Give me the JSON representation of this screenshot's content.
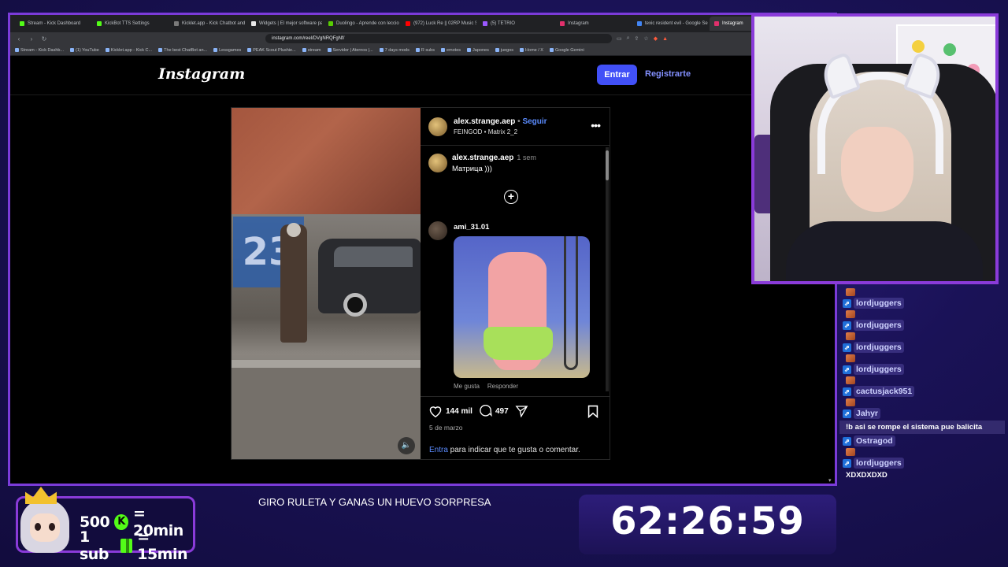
{
  "browser": {
    "tabs": [
      {
        "label": "Stream - Kick Dashboard",
        "color": "#53fc18"
      },
      {
        "label": "KickBot TTS Settings",
        "color": "#53fc18"
      },
      {
        "label": "Kicklet.app - Kick Chatbot and Ov...",
        "color": "#7a7a7a"
      },
      {
        "label": "Widgets | El mejor software para ...",
        "color": "#e8e8e8"
      },
      {
        "label": "Duolingo - Aprende con lecciones ...",
        "color": "#58cc02"
      },
      {
        "label": "(972) Luck Re || 02RP Music Sessio...",
        "color": "#ff0000"
      },
      {
        "label": "(5) TETRIO",
        "color": "#9b59ff"
      },
      {
        "label": "Instagram",
        "color": "#e1306c"
      },
      {
        "label": "texic resident evil - Google Search",
        "color": "#4285f4"
      },
      {
        "label": "Instagram",
        "color": "#e1306c"
      }
    ],
    "url": "instagram.com/reel/DVgNRQFgNf/",
    "bookmarks": [
      "Stream - Kick Dashb...",
      "(1) YouTube",
      "Kicklet.app - Kick C...",
      "The best ChatBot an...",
      "Lessgames",
      "PEAK Scout Plushie...",
      "stream",
      "Servidor | Aternos |...",
      "7 days mods",
      "R subs",
      "emotes",
      "Japones",
      "juegos",
      "Home / X",
      "Google Gemini"
    ]
  },
  "instagram": {
    "logo": "Instagram",
    "login_label": "Entrar",
    "signup_label": "Registrarte",
    "post": {
      "username": "alex.strange.aep",
      "follow_sep": " • ",
      "follow_label": "Seguir",
      "audio": "FEINGOD • Matrix 2_2",
      "graffiti": "23",
      "caption": {
        "username": "alex.strange.aep",
        "time": "1 sem",
        "text": "Матрица )))"
      },
      "comment": {
        "username": "ami_31.01",
        "like_label": "Me gusta",
        "reply_label": "Responder"
      },
      "likes": "144 mil",
      "comments_count": "497",
      "date": "5 de marzo",
      "cta_link": "Entra",
      "cta_text": " para indicar que te gusta o comentar."
    }
  },
  "chat": {
    "messages": [
      {
        "user": "lordjuggers",
        "type": "emote"
      },
      {
        "user": "lordjuggers",
        "type": "emote"
      },
      {
        "user": "lordjuggers",
        "type": "emote"
      },
      {
        "user": "lordjuggers",
        "type": "emote"
      },
      {
        "user": "cactusjack951",
        "type": "emote"
      },
      {
        "user": "Jahyr",
        "text": "!b asi se rompe el sistema pue balicita"
      },
      {
        "user": "Ostragod",
        "type": "emote"
      },
      {
        "user": "lordjuggers",
        "text": "XDXDXDXD"
      }
    ]
  },
  "overlay": {
    "reward1_amount": "500",
    "reward1_coin": "K",
    "reward1_time": "= 20min",
    "reward2_amount": "1 sub",
    "reward2_time": "= 15min",
    "ticker": "GIRO RULETA Y GANAS UN HUEVO SORPRESA",
    "timer": "62:26:59"
  }
}
